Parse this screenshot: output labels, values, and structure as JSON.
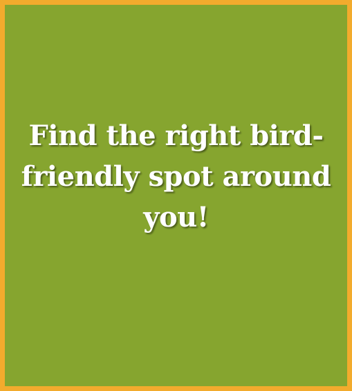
{
  "card": {
    "headline_lines": [
      "Find the right bird-",
      "friendly spot around",
      "you!"
    ]
  },
  "colors": {
    "background": "#86a52f",
    "border": "#f2ab2d",
    "text": "#ffffff"
  }
}
